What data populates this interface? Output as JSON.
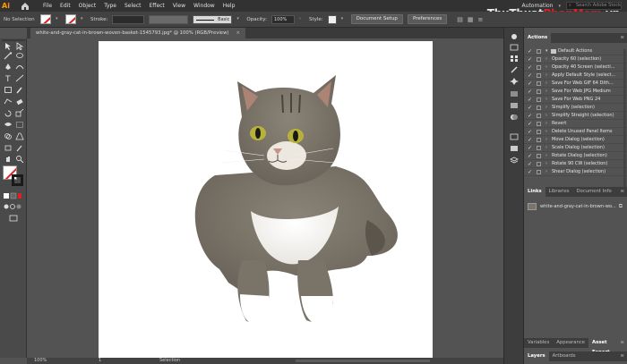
{
  "app": {
    "logo": "Ai",
    "search_placeholder": "Search Adobe Stock",
    "workspace": "Automation"
  },
  "menu": [
    "File",
    "Edit",
    "Object",
    "Type",
    "Select",
    "Effect",
    "View",
    "Window",
    "Help"
  ],
  "watermark": {
    "part1": "ThuThuat",
    "part2": "PhanMem",
    "part3": ".vn"
  },
  "controlbar": {
    "selection_label": "No Selection",
    "stroke_label": "Stroke:",
    "brush_label": "Basic",
    "opacity_label": "Opacity:",
    "opacity_value": "100%",
    "style_label": "Style:",
    "document_setup": "Document Setup",
    "preferences": "Preferences"
  },
  "document_tab": {
    "title": "white-and-gray-cat-in-brown-woven-basket-1545793.jpg* @ 100% (RGB/Preview)",
    "close": "×"
  },
  "statusbar": {
    "zoom": "100%",
    "page": "1",
    "mode": "Selection"
  },
  "panels": {
    "actions_tab": "Actions",
    "actions": [
      {
        "label": "Default Actions",
        "type": "folder"
      },
      {
        "label": "Opacity 60 (selection)"
      },
      {
        "label": "Opacity 40 Screen (selecti..."
      },
      {
        "label": "Apply Default Style (select..."
      },
      {
        "label": "Save For Web GIF 64 Dith..."
      },
      {
        "label": "Save For Web JPG Medium"
      },
      {
        "label": "Save For Web PNG 24"
      },
      {
        "label": "Simplify (selection)"
      },
      {
        "label": "Simplify Straight (selection)"
      },
      {
        "label": "Revert"
      },
      {
        "label": "Delete Unused Panel Items"
      },
      {
        "label": "Move Dialog (selection)"
      },
      {
        "label": "Scale Dialog (selection)"
      },
      {
        "label": "Rotate Dialog (selection)"
      },
      {
        "label": "Rotate 90 CW (selection)"
      },
      {
        "label": "Shear Dialog (selection)"
      }
    ],
    "links_tabs": [
      "Links",
      "Libraries",
      "Document Info"
    ],
    "links_item": "white-and-gray-cat-in-brown-wo...",
    "bottom_tabs1": [
      "Variables",
      "Appearance",
      "Asset Export"
    ],
    "bottom_tabs2": [
      "Layers",
      "Artboards"
    ]
  },
  "colors": {
    "accent_red": "#d72229",
    "logo_orange": "#ff9a00",
    "panel_bg": "#535353",
    "menubar_bg": "#323232"
  },
  "icons": [
    "home-icon",
    "search-icon",
    "selection-tool-icon",
    "direct-selection-tool-icon",
    "pen-tool-icon",
    "type-tool-icon",
    "rectangle-tool-icon",
    "zoom-tool-icon",
    "hand-tool-icon",
    "fill-stroke-icon"
  ]
}
